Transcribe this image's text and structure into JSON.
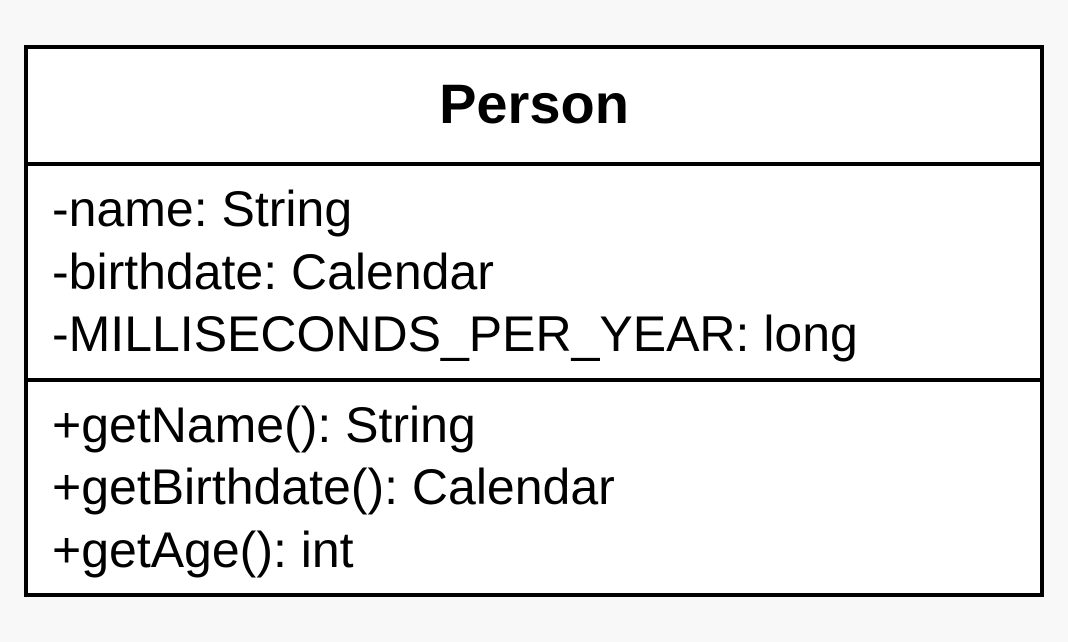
{
  "class": {
    "name": "Person",
    "attributes": [
      {
        "text": "-name: String"
      },
      {
        "text": "-birthdate: Calendar"
      },
      {
        "text": "-MILLISECONDS_PER_YEAR: long"
      }
    ],
    "methods": [
      {
        "text": "+getName(): String"
      },
      {
        "text": "+getBirthdate(): Calendar"
      },
      {
        "text": "+getAge(): int"
      }
    ]
  }
}
